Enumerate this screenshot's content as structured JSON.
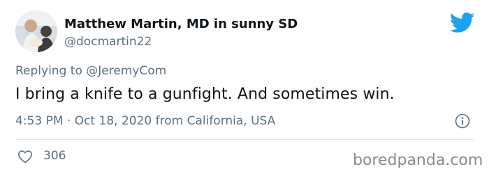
{
  "tweet": {
    "author": {
      "display_name": "Matthew Martin, MD in sunny SD",
      "handle": "@docmartin22"
    },
    "replying_prefix": "Replying to",
    "replying_to": "@JeremyCom",
    "text": "I bring a knife to a gunfight. And sometimes win.",
    "timestamp": "4:53 PM · Oct 18, 2020 from California, USA",
    "likes": "306"
  },
  "watermark": "boredpanda.com",
  "colors": {
    "twitter_blue": "#1da1f2",
    "secondary_text": "#5b7083",
    "divider": "#e1e8ed"
  },
  "icons": {
    "brand": "twitter-bird-icon",
    "info": "info-icon",
    "like": "heart-outline-icon"
  }
}
